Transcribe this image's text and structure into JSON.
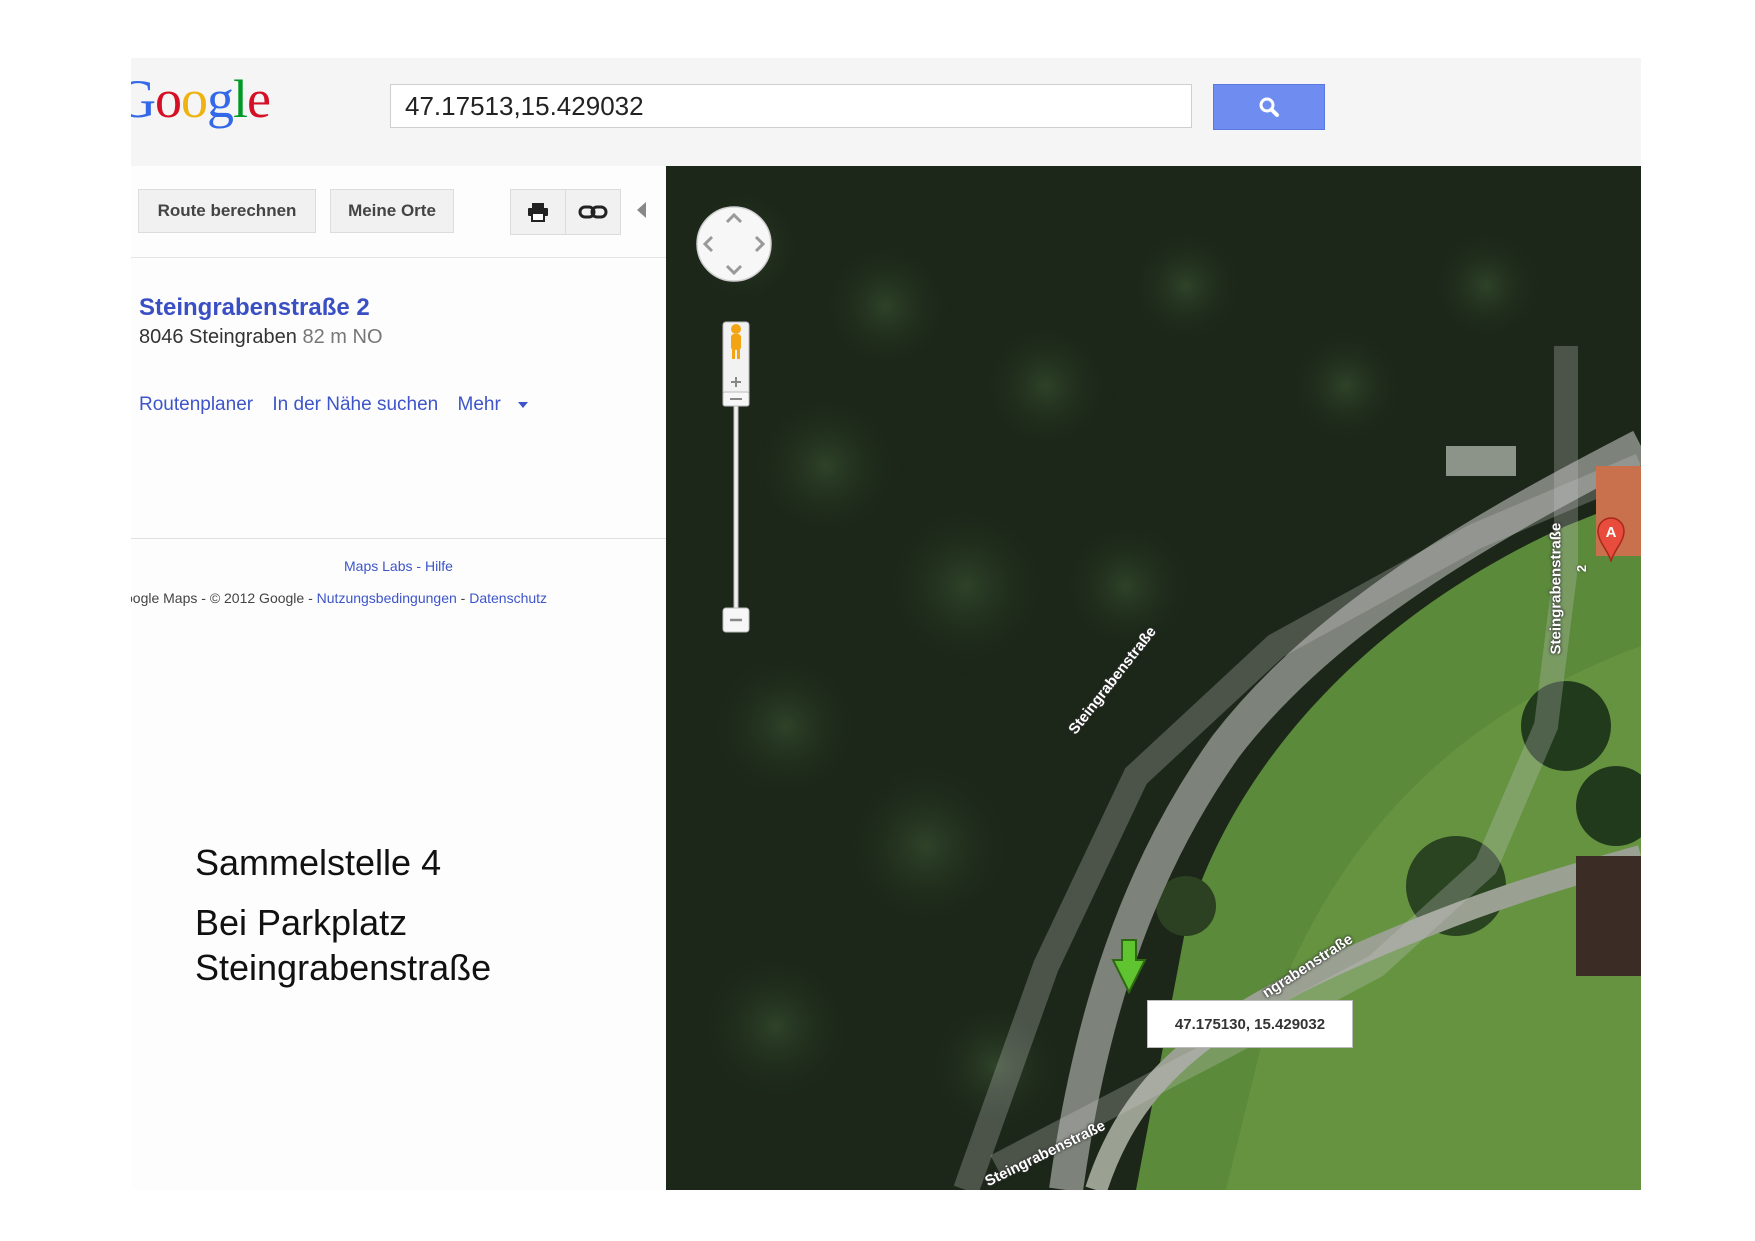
{
  "header": {
    "logo_letters": [
      {
        "ch": "G",
        "color": "#3369e8"
      },
      {
        "ch": "o",
        "color": "#d50f25"
      },
      {
        "ch": "o",
        "color": "#eeb211"
      },
      {
        "ch": "g",
        "color": "#3369e8"
      },
      {
        "ch": "l",
        "color": "#009925"
      },
      {
        "ch": "e",
        "color": "#d50f25"
      }
    ],
    "search_value": "47.17513,15.429032",
    "search_icon": "search-icon"
  },
  "panel": {
    "buttons": {
      "route": "Route berechnen",
      "places": "Meine Orte",
      "print_icon": "print-icon",
      "link_icon": "link-icon"
    },
    "result": {
      "title": "Steingrabenstraße 2",
      "address": "8046 Steingraben",
      "distance": "82 m NO"
    },
    "actions": {
      "route_planner": "Routenplaner",
      "nearby": "In der Nähe suchen",
      "more": "Mehr"
    },
    "footer": {
      "labs": "Maps Labs",
      "dash": " - ",
      "help": "Hilfe",
      "copyright": "oogle Maps - © 2012 Google - ",
      "terms": "Nutzungsbedingungen",
      "privacy": "Datenschutz"
    }
  },
  "caption": {
    "line1": "Sammelstelle 4",
    "line2a": "Bei Parkplatz",
    "line2b": "Steingrabenstraße"
  },
  "map": {
    "coordinate_label": "47.175130, 15.429032",
    "marker_letter": "A",
    "street_labels": [
      "Steingrabenstraße",
      "Steingrabenstraße",
      "ngrabenstraße",
      "Steingrabenstraße"
    ],
    "house_number": "2",
    "colors": {
      "forest": "#1a2418",
      "meadow": "#5d8a3c",
      "road": "#8b9088",
      "marker_green": "#5fc42f",
      "marker_red": "#e84c3d"
    }
  }
}
